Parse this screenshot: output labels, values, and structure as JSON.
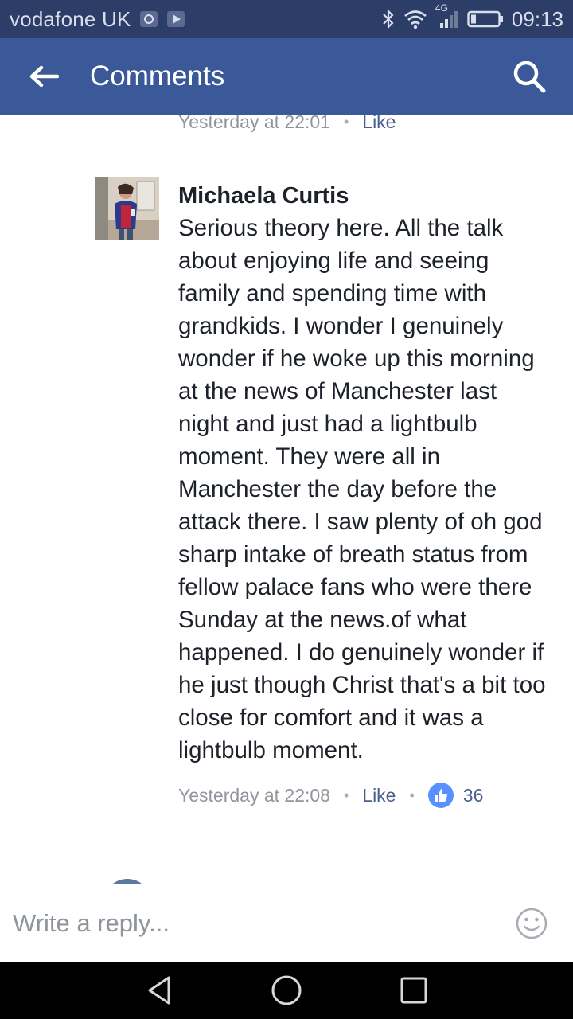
{
  "status_bar": {
    "carrier": "vodafone UK",
    "network": "4G",
    "time": "09:13"
  },
  "app_bar": {
    "title": "Comments"
  },
  "previous_comment": {
    "timestamp": "Yesterday at 22:01",
    "like_label": "Like"
  },
  "comment": {
    "author": "Michaela Curtis",
    "text": "Serious theory here. All the talk about enjoying life and seeing family and spending time with grandkids. I wonder I genuinely wonder if he woke up this morning at the news of Manchester last night and just had a lightbulb moment. They were all in Manchester the day before the attack there. I saw plenty of oh god sharp intake of breath status from fellow palace fans who were there Sunday at the news.of what happened. I do genuinely wonder if he just though Christ that's a bit too close for comfort and it was a lightbulb moment.",
    "timestamp": "Yesterday at 22:08",
    "like_label": "Like",
    "like_count": "36"
  },
  "reply": {
    "placeholder": "Write a reply..."
  },
  "colors": {
    "status_bar": "#2c3d67",
    "app_bar": "#3b5998",
    "link": "#4b5f8f",
    "like_badge": "#5890ff"
  },
  "icons": {
    "back": "arrow-left-icon",
    "search": "search-icon",
    "emoji": "smiley-icon",
    "like": "thumbs-up-icon",
    "nav_back": "triangle-back-icon",
    "nav_home": "circle-home-icon",
    "nav_recent": "square-recent-icon"
  }
}
